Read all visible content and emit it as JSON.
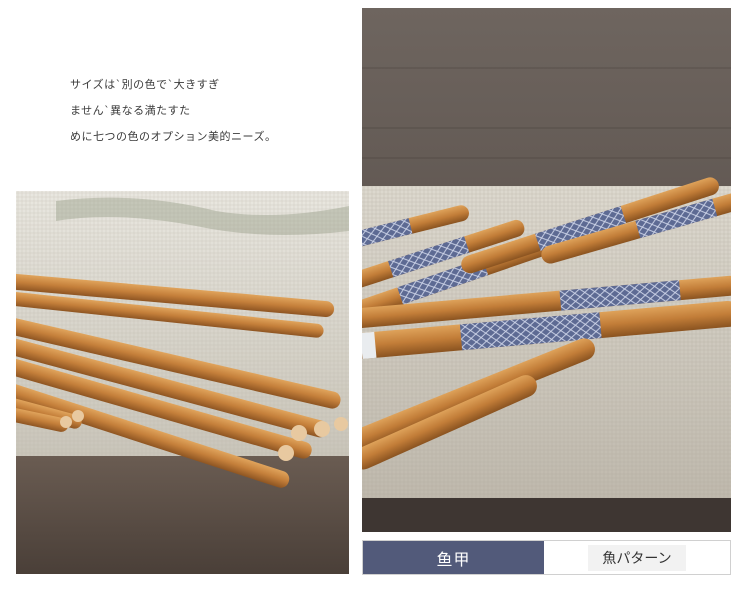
{
  "intro": {
    "line1": "サイズは`別の色で`大きすぎ",
    "line2": "ません`異なる満たすた",
    "line3": "めに七つの色のオプション美的ニーズ。"
  },
  "photos": {
    "left_alt": "bamboo-chopsticks-closeup",
    "right_alt": "fish-scale-pattern-chopsticks"
  },
  "options": {
    "selected_label": "鱼甲",
    "other_label": "魚パターン",
    "selected_color": "#525a7a"
  }
}
